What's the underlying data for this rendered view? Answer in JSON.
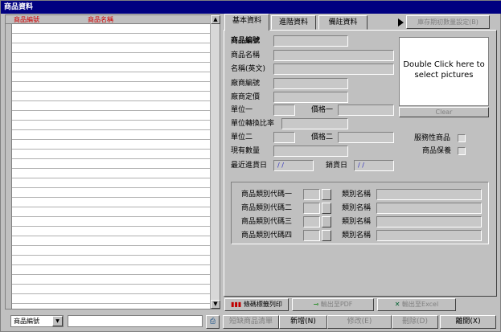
{
  "window": {
    "title": "商品資料"
  },
  "grid": {
    "columns": [
      "商品編號",
      "商品名稱"
    ],
    "scroll_up": "▲",
    "scroll_down": "▼"
  },
  "search": {
    "field_selected": "商品編號",
    "field_arrow": "▼",
    "value": "",
    "print_icon": "⎙"
  },
  "tabs": [
    {
      "label": "基本資料",
      "active": true
    },
    {
      "label": "進階資料",
      "active": false
    },
    {
      "label": "備註資料",
      "active": false
    }
  ],
  "top_action": {
    "arrow": "▶",
    "label": "庫存期初數量設定(B)"
  },
  "form": {
    "product_code": {
      "label": "商品編號",
      "value": ""
    },
    "product_name": {
      "label": "商品名稱",
      "value": ""
    },
    "name_en": {
      "label": "名稱(英文)",
      "value": ""
    },
    "vendor_code": {
      "label": "廠商編號",
      "value": ""
    },
    "vendor_price": {
      "label": "廠商定價",
      "value": ""
    },
    "unit1": {
      "label": "單位一",
      "value": ""
    },
    "price1": {
      "label": "價格一",
      "value": ""
    },
    "unit_ratio": {
      "label": "單位轉換比率",
      "value": ""
    },
    "unit2": {
      "label": "單位二",
      "value": ""
    },
    "price2": {
      "label": "價格二",
      "value": ""
    },
    "stock": {
      "label": "現有數量",
      "value": ""
    },
    "last_in_date": {
      "label": "最近進貨日",
      "value": " / /"
    },
    "sale_date": {
      "label": "銷貨日",
      "value": " / /"
    },
    "service_item": {
      "label": "服務性商品"
    },
    "warranty": {
      "label": "商品保養"
    }
  },
  "picture": {
    "hint": "Double Click here to select pictures",
    "clear_label": "Clear"
  },
  "categories": {
    "code_labels": [
      "商品類別代碼一",
      "商品類別代碼二",
      "商品類別代碼三",
      "商品類別代碼四"
    ],
    "name_label": "類別名稱"
  },
  "action_row": {
    "barcode": {
      "icon": "▮▮▮",
      "label": "條碼標籤列印"
    },
    "export_pdf": {
      "icon": "⊸",
      "label": "輸出至PDF"
    },
    "export_excel": {
      "icon": "✕",
      "label": "輸出至Excel"
    }
  },
  "bottom_buttons": {
    "shortage": "短缺商品清單",
    "add": "新增(N)",
    "edit": "修改(E)",
    "delete": "刪除(D)",
    "leave": "離開(X)"
  }
}
